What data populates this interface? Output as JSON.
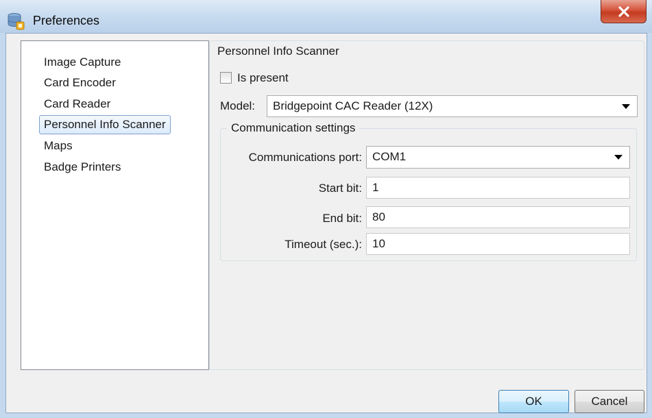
{
  "window": {
    "title": "Preferences",
    "icon": "database-icon",
    "close_icon": "close-x-icon"
  },
  "nav": {
    "items": [
      {
        "label": "Image Capture"
      },
      {
        "label": "Card Encoder"
      },
      {
        "label": "Card Reader"
      },
      {
        "label": "Personnel Info Scanner"
      },
      {
        "label": "Maps"
      },
      {
        "label": "Badge Printers"
      }
    ],
    "selected_index": 3
  },
  "panel": {
    "title": "Personnel Info Scanner",
    "is_present_label": "Is present",
    "is_present_checked": false,
    "model_label": "Model:",
    "model_value": "Bridgepoint CAC Reader (12X)",
    "comm": {
      "title": "Communication settings",
      "port_label": "Communications port:",
      "port_value": "COM1",
      "start_bit_label": "Start bit:",
      "start_bit_value": "1",
      "end_bit_label": "End bit:",
      "end_bit_value": "80",
      "timeout_label": "Timeout (sec.):",
      "timeout_value": "10"
    }
  },
  "buttons": {
    "ok": "OK",
    "cancel": "Cancel"
  },
  "colors": {
    "titlebar": "#c9dcf0",
    "close_button": "#c43b21",
    "selection_border": "#7da2ce",
    "ok_button_border": "#3c7fb1"
  }
}
